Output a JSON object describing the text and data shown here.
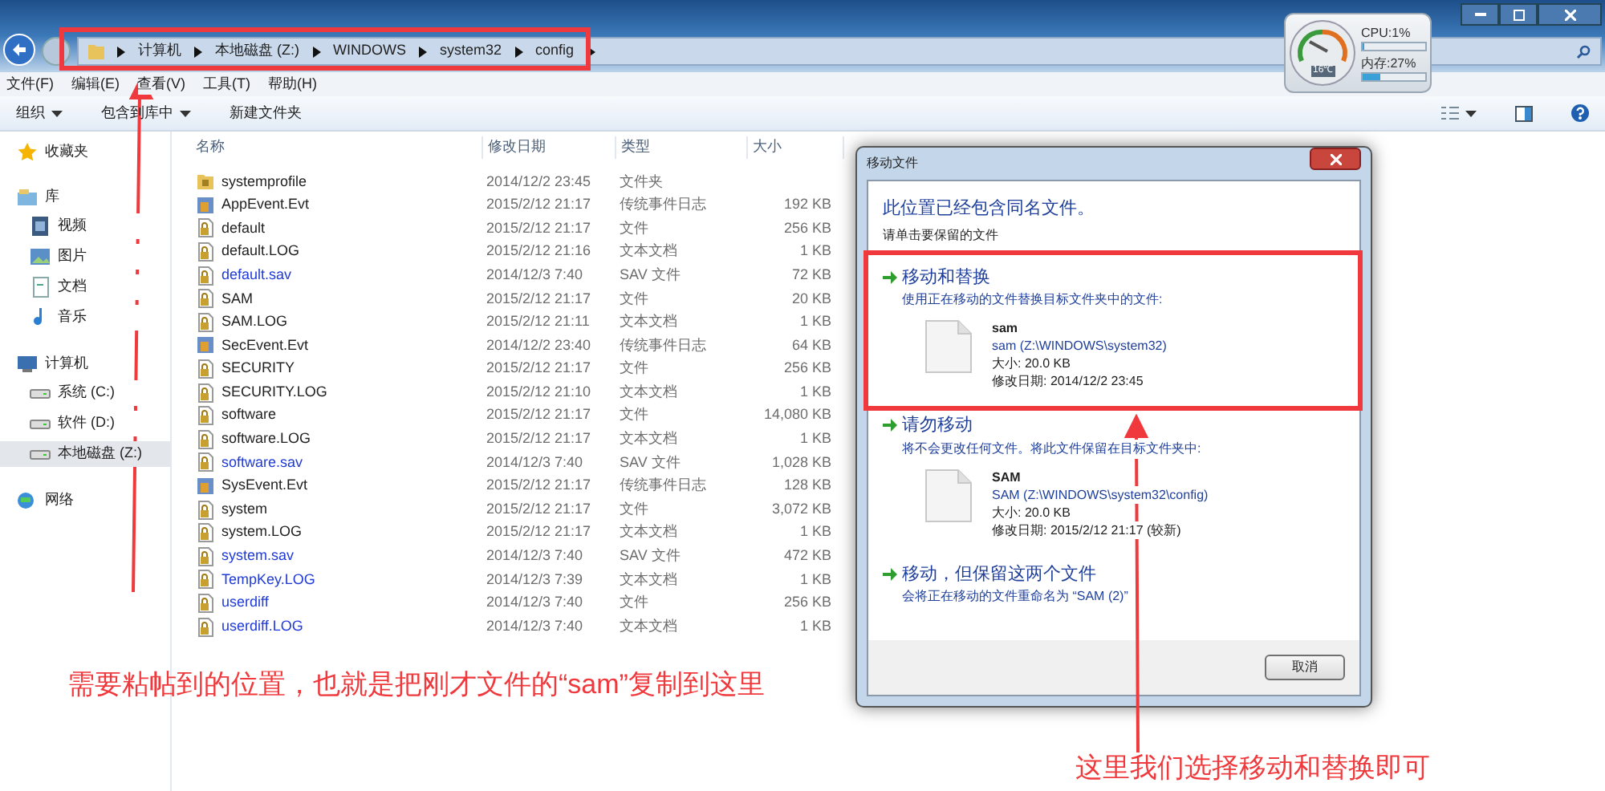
{
  "address_bar": {
    "segments": [
      "计算机",
      "本地磁盘 (Z:)",
      "WINDOWS",
      "system32",
      "config"
    ]
  },
  "menu_bar": [
    "文件(F)",
    "编辑(E)",
    "查看(V)",
    "工具(T)",
    "帮助(H)"
  ],
  "toolbar": [
    {
      "label": "组织",
      "dropdown": true
    },
    {
      "label": "包含到库中",
      "dropdown": true
    },
    {
      "label": "新建文件夹",
      "dropdown": false
    }
  ],
  "sidebar": [
    {
      "label": "收藏夹",
      "selected": false
    },
    {
      "label": "库",
      "selected": false,
      "children": [
        {
          "label": "视频",
          "selected": false
        },
        {
          "label": "图片",
          "selected": false
        },
        {
          "label": "文档",
          "selected": false
        },
        {
          "label": "音乐",
          "selected": false
        }
      ]
    },
    {
      "label": "计算机",
      "selected": false,
      "children": [
        {
          "label": "系统 (C:)",
          "selected": false
        },
        {
          "label": "软件 (D:)",
          "selected": false
        },
        {
          "label": "本地磁盘 (Z:)",
          "selected": true
        }
      ]
    },
    {
      "label": "网络",
      "selected": false
    }
  ],
  "table": {
    "columns": [
      "名称",
      "修改日期",
      "类型",
      "大小"
    ],
    "rows": [
      {
        "kind": "folder",
        "compressed": false,
        "name": "systemprofile",
        "date": "2014/12/2 23:45",
        "type": "文件夹",
        "size": ""
      },
      {
        "kind": "evt",
        "compressed": false,
        "name": "AppEvent.Evt",
        "date": "2015/2/12 21:17",
        "type": "传统事件日志",
        "size": "192 KB"
      },
      {
        "kind": "file",
        "compressed": false,
        "name": "default",
        "date": "2015/2/12 21:17",
        "type": "文件",
        "size": "256 KB"
      },
      {
        "kind": "file",
        "compressed": false,
        "name": "default.LOG",
        "date": "2015/2/12 21:16",
        "type": "文本文档",
        "size": "1 KB"
      },
      {
        "kind": "file",
        "compressed": true,
        "name": "default.sav",
        "date": "2014/12/3 7:40",
        "type": "SAV 文件",
        "size": "72 KB"
      },
      {
        "kind": "file",
        "compressed": false,
        "name": "SAM",
        "date": "2015/2/12 21:17",
        "type": "文件",
        "size": "20 KB"
      },
      {
        "kind": "file",
        "compressed": false,
        "name": "SAM.LOG",
        "date": "2015/2/12 21:11",
        "type": "文本文档",
        "size": "1 KB"
      },
      {
        "kind": "evt",
        "compressed": false,
        "name": "SecEvent.Evt",
        "date": "2014/12/2 23:40",
        "type": "传统事件日志",
        "size": "64 KB"
      },
      {
        "kind": "file",
        "compressed": false,
        "name": "SECURITY",
        "date": "2015/2/12 21:17",
        "type": "文件",
        "size": "256 KB"
      },
      {
        "kind": "file",
        "compressed": false,
        "name": "SECURITY.LOG",
        "date": "2015/2/12 21:10",
        "type": "文本文档",
        "size": "1 KB"
      },
      {
        "kind": "file",
        "compressed": false,
        "name": "software",
        "date": "2015/2/12 21:17",
        "type": "文件",
        "size": "14,080 KB"
      },
      {
        "kind": "file",
        "compressed": false,
        "name": "software.LOG",
        "date": "2015/2/12 21:17",
        "type": "文本文档",
        "size": "1 KB"
      },
      {
        "kind": "file",
        "compressed": true,
        "name": "software.sav",
        "date": "2014/12/3 7:40",
        "type": "SAV 文件",
        "size": "1,028 KB"
      },
      {
        "kind": "evt",
        "compressed": false,
        "name": "SysEvent.Evt",
        "date": "2015/2/12 21:17",
        "type": "传统事件日志",
        "size": "128 KB"
      },
      {
        "kind": "file",
        "compressed": false,
        "name": "system",
        "date": "2015/2/12 21:17",
        "type": "文件",
        "size": "3,072 KB"
      },
      {
        "kind": "file",
        "compressed": false,
        "name": "system.LOG",
        "date": "2015/2/12 21:17",
        "type": "文本文档",
        "size": "1 KB"
      },
      {
        "kind": "file",
        "compressed": true,
        "name": "system.sav",
        "date": "2014/12/3 7:40",
        "type": "SAV 文件",
        "size": "472 KB"
      },
      {
        "kind": "file",
        "compressed": true,
        "name": "TempKey.LOG",
        "date": "2014/12/3 7:39",
        "type": "文本文档",
        "size": "1 KB"
      },
      {
        "kind": "file",
        "compressed": true,
        "name": "userdiff",
        "date": "2014/12/3 7:40",
        "type": "文件",
        "size": "256 KB"
      },
      {
        "kind": "file",
        "compressed": true,
        "name": "userdiff.LOG",
        "date": "2014/12/3 7:40",
        "type": "文本文档",
        "size": "1 KB"
      }
    ]
  },
  "gadget": {
    "temperature": "16℃",
    "cpu": {
      "label": "CPU:1%",
      "level": 0.01
    },
    "memory": {
      "label": "内存:27%",
      "level": 0.27
    }
  },
  "dialog": {
    "title": "移动文件",
    "heading": "此位置已经包含同名文件。",
    "subheading": "请单击要保留的文件",
    "options": [
      {
        "title": "移动和替换",
        "description": "使用正在移动的文件替换目标文件夹中的文件:",
        "file": {
          "name": "sam",
          "path": "sam (Z:\\WINDOWS\\system32)",
          "size": "大小: 20.0 KB",
          "date": "修改日期: 2014/12/2 23:45"
        }
      },
      {
        "title": "请勿移动",
        "description": "将不会更改任何文件。将此文件保留在目标文件夹中:",
        "file": {
          "name": "SAM",
          "path": "SAM (Z:\\WINDOWS\\system32\\config)",
          "size": "大小: 20.0 KB",
          "date": "修改日期: 2015/2/12 21:17 (较新)"
        }
      },
      {
        "title": "移动，但保留这两个文件",
        "description": "会将正在移动的文件重命名为 “SAM (2)”"
      }
    ],
    "cancel_button": "取消"
  },
  "annotations": [
    "需要粘帖到的位置，也就是把刚才文件的“sam”复制到这里",
    "这里我们选择移动和替换即可"
  ]
}
